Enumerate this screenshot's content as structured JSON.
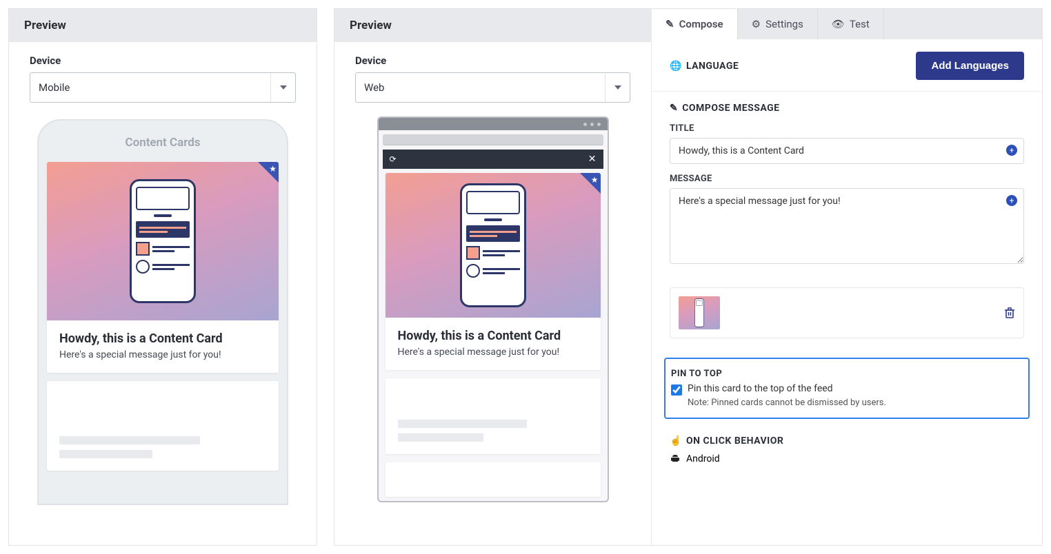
{
  "left": {
    "header": "Preview",
    "deviceLabel": "Device",
    "device": "Mobile",
    "feedTitle": "Content Cards",
    "cardTitle": "Howdy, this is a Content Card",
    "cardMsg": "Here's a special message just for you!"
  },
  "mid": {
    "header": "Preview",
    "deviceLabel": "Device",
    "device": "Web",
    "cardTitle": "Howdy, this is a Content Card",
    "cardMsg": "Here's a special message just for you!"
  },
  "tabs": {
    "compose": "Compose",
    "settings": "Settings",
    "test": "Test"
  },
  "lang": {
    "label": "LANGUAGE",
    "button": "Add Languages"
  },
  "composeSection": "COMPOSE MESSAGE",
  "titleLabel": "TITLE",
  "titleValue": "Howdy, this is a Content Card",
  "msgLabel": "MESSAGE",
  "msgValue": "Here's a special message just for you!",
  "pin": {
    "header": "PIN TO TOP",
    "label": "Pin this card to the top of the feed",
    "note": "Note: Pinned cards cannot be dismissed by users."
  },
  "click": {
    "header": "ON CLICK BEHAVIOR",
    "android": "Android"
  }
}
